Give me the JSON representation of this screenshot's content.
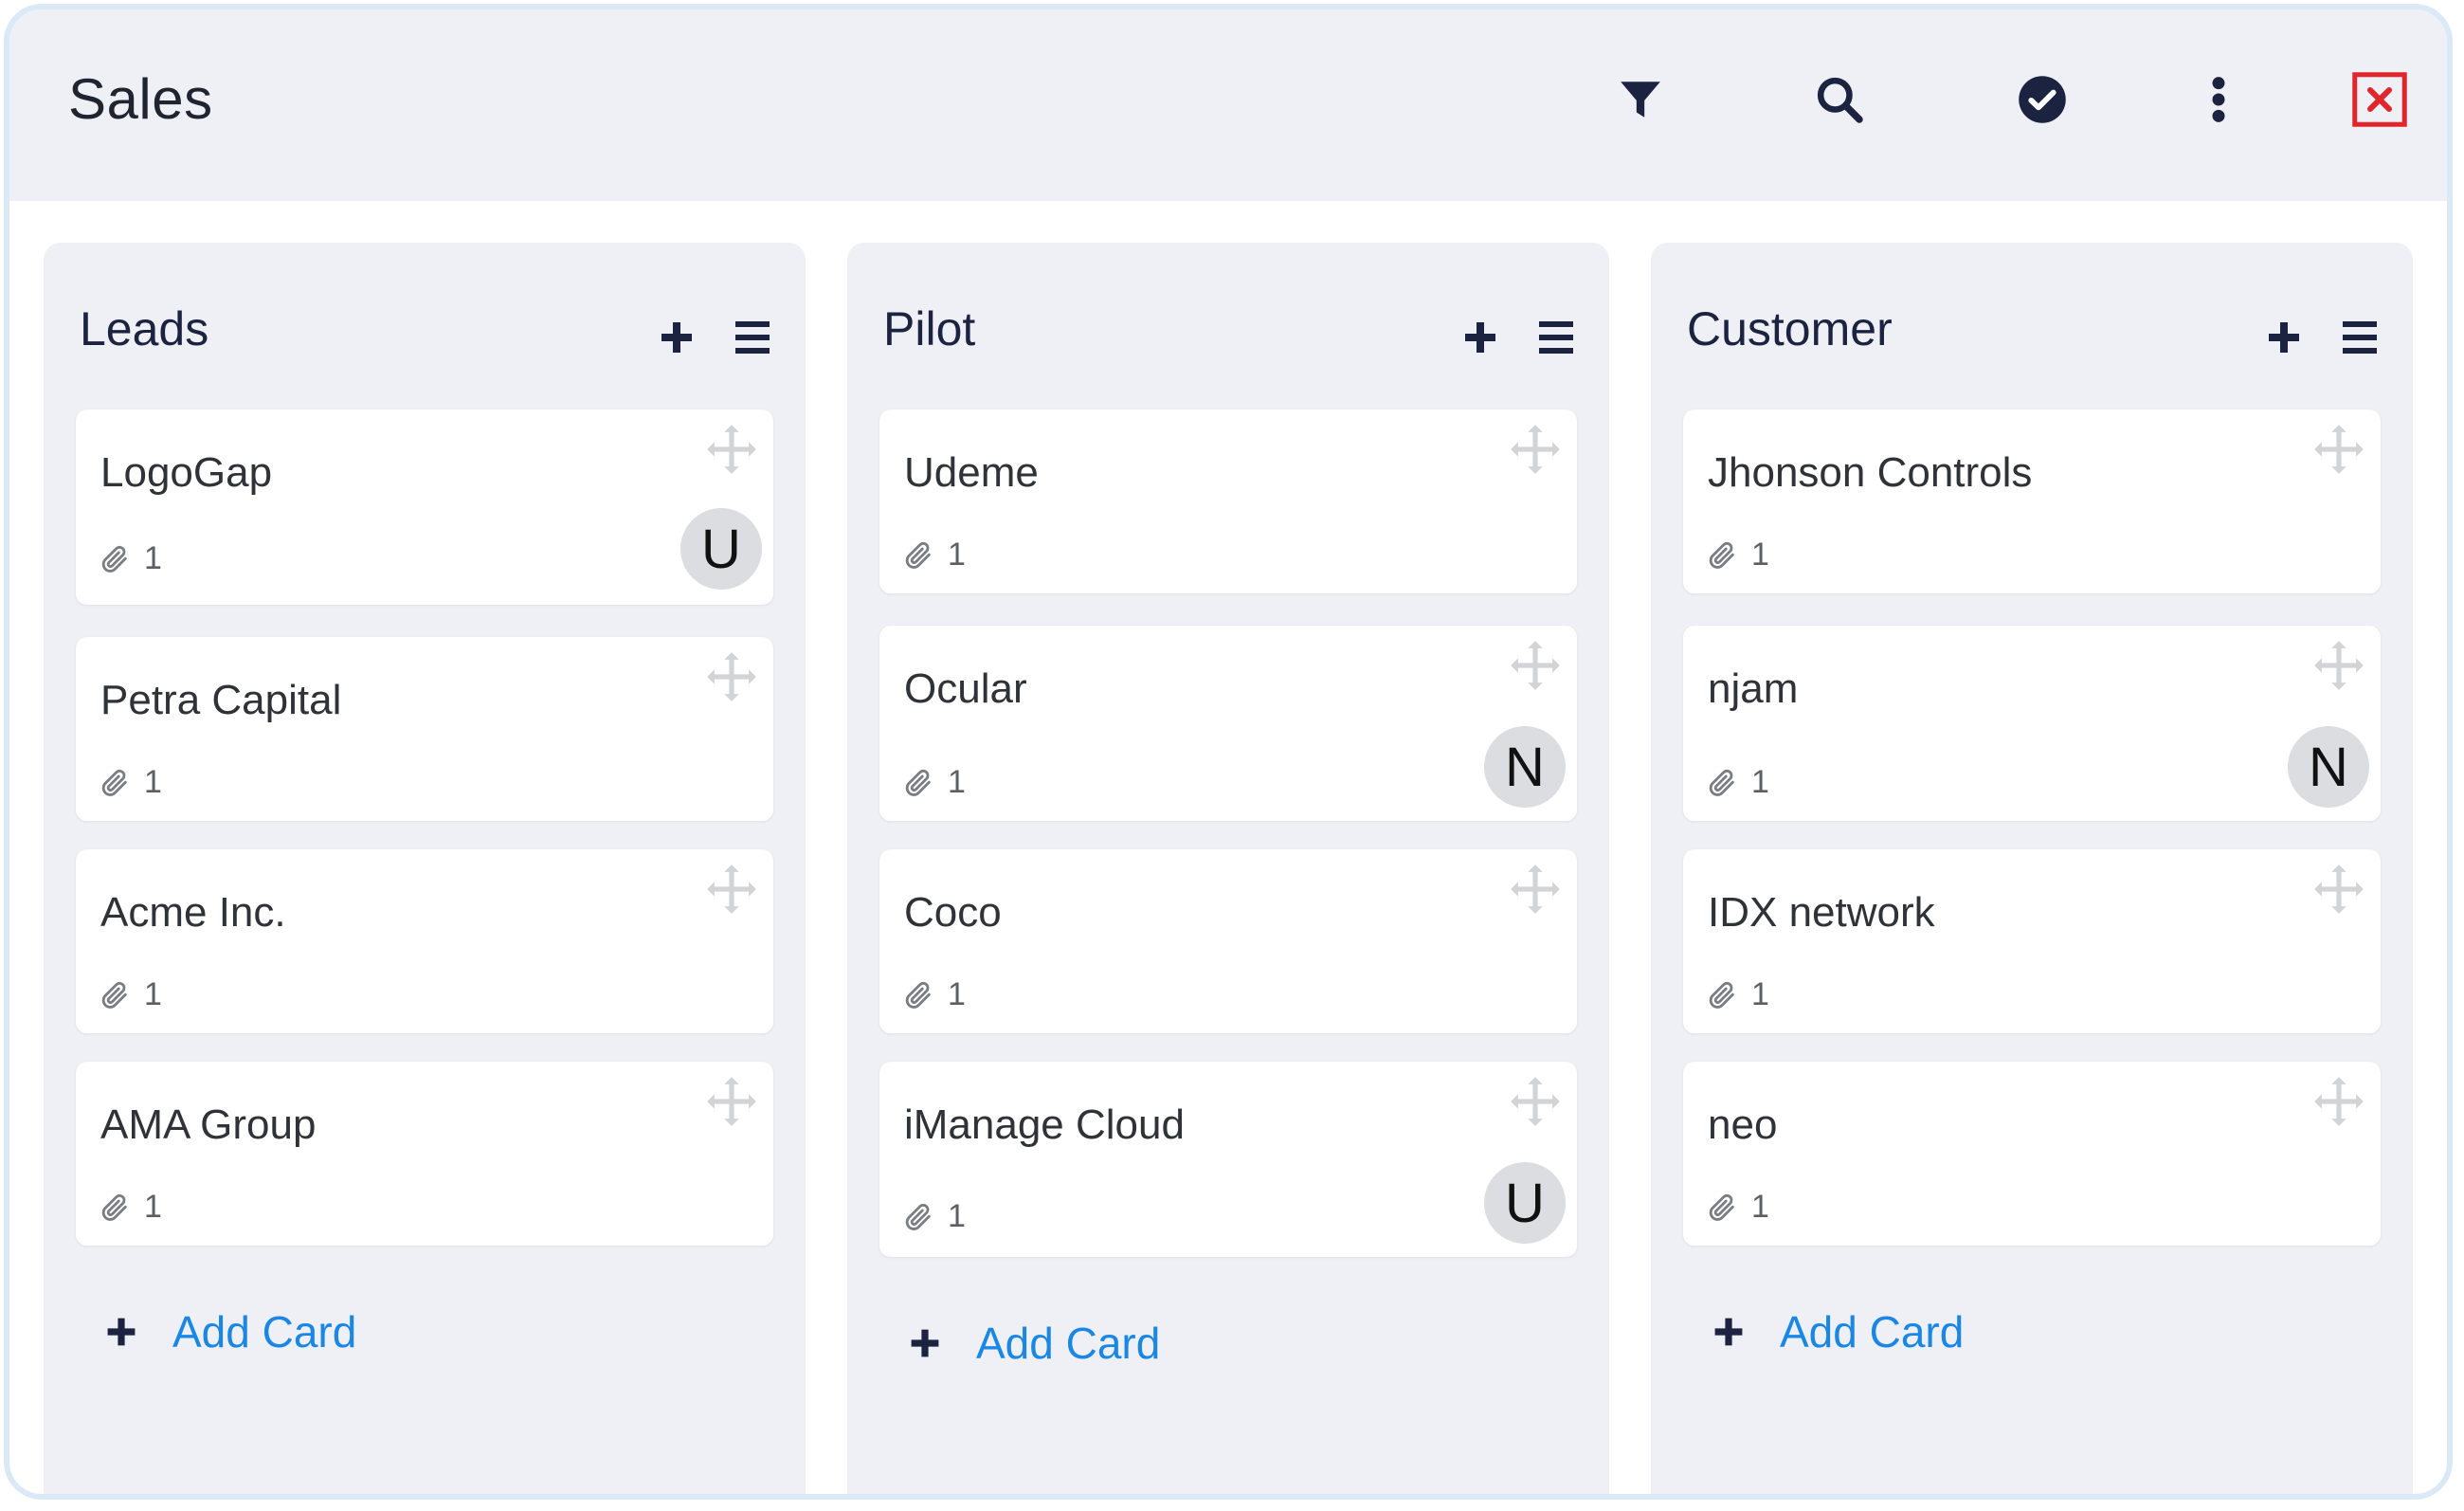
{
  "header": {
    "title": "Sales",
    "icons": {
      "filter": "filter-icon",
      "search": "search-icon",
      "check": "check-circle-icon",
      "more": "more-vertical-icon",
      "close": "close-icon"
    },
    "close_color": "#e0262b"
  },
  "colors": {
    "accent": "#1a87e5",
    "avatar_bg": "#dcdde0",
    "column_bg": "#eef0f5"
  },
  "columns": [
    {
      "title": "Leads",
      "add_label": "Add Card",
      "cards": [
        {
          "name": "LogoGap",
          "attachments": "1",
          "avatar": "U"
        },
        {
          "name": "Petra Capital",
          "attachments": "1"
        },
        {
          "name": "Acme Inc.",
          "attachments": "1"
        },
        {
          "name": "AMA Group",
          "attachments": "1"
        }
      ]
    },
    {
      "title": "Pilot",
      "add_label": "Add Card",
      "cards": [
        {
          "name": "Udeme",
          "attachments": "1"
        },
        {
          "name": "Ocular",
          "attachments": "1",
          "avatar": "N"
        },
        {
          "name": "Coco",
          "attachments": "1"
        },
        {
          "name": "iManage Cloud",
          "attachments": "1",
          "avatar": "U"
        }
      ]
    },
    {
      "title": "Customer",
      "add_label": "Add Card",
      "cards": [
        {
          "name": "Jhonson Controls",
          "attachments": "1"
        },
        {
          "name": "njam",
          "attachments": "1",
          "avatar": "N"
        },
        {
          "name": "IDX network",
          "attachments": "1"
        },
        {
          "name": "neo",
          "attachments": "1"
        }
      ]
    }
  ]
}
